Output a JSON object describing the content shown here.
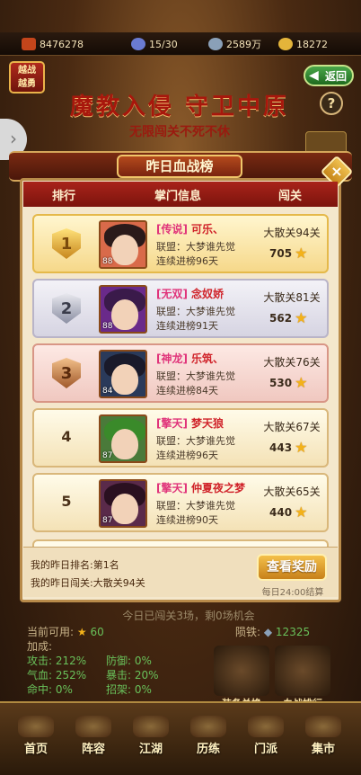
{
  "top_bar": {
    "power_icon_text": "功力",
    "power": "8476278",
    "stamina": "15/30",
    "silver": "2589万",
    "gold": "18272"
  },
  "banner": {
    "side_badge_line1": "越战",
    "side_badge_line2": "越勇",
    "back_label": "返回",
    "title": "魔教入侵 守卫中原",
    "subtitle": "无限闯关不死不休",
    "help": "?"
  },
  "modal": {
    "title": "昨日血战榜",
    "close": "×",
    "columns": {
      "rank": "排行",
      "info": "掌门信息",
      "stage": "闯关"
    },
    "rows": [
      {
        "rank": "1",
        "title": "[传说]",
        "name": "可乐、",
        "alliance": "联盟：大梦谁先觉",
        "streak": "连续进榜96天",
        "stage": "大散关94关",
        "stars": "705",
        "level": "88"
      },
      {
        "rank": "2",
        "title": "[无双]",
        "name": "念奴娇",
        "alliance": "联盟：大梦谁先觉",
        "streak": "连续进榜91天",
        "stage": "大散关81关",
        "stars": "562",
        "level": "88"
      },
      {
        "rank": "3",
        "title": "[神龙]",
        "name": "乐筑、",
        "alliance": "联盟：大梦谁先觉",
        "streak": "连续进榜84天",
        "stage": "大散关76关",
        "stars": "530",
        "level": "84"
      },
      {
        "rank": "4",
        "title": "[擎天]",
        "name": "梦天狼",
        "alliance": "联盟：大梦谁先觉",
        "streak": "连续进榜96天",
        "stage": "大散关67关",
        "stars": "443",
        "level": "87"
      },
      {
        "rank": "5",
        "title": "[擎天]",
        "name": "仲夏夜之梦",
        "alliance": "联盟：大梦谁先觉",
        "streak": "连续进榜90天",
        "stage": "大散关65关",
        "stars": "440",
        "level": "87"
      }
    ],
    "my_rank": "我的昨日排名:第1名",
    "my_stage": "我的昨日闯关:大散关94关",
    "reward_button": "查看奖励",
    "settle_note": "每日24:00结算"
  },
  "lower": {
    "today_note": "今日已闯关3场，剩0场机会",
    "available_label": "当前可用:",
    "available_value": "60",
    "meteor_label": "陨铁:",
    "meteor_value": "12325",
    "bonus_label": "加成:",
    "attack": "攻击: 212%",
    "defense": "防御: 0%",
    "hp": "气血: 252%",
    "crit": "暴击: 20%",
    "hit": "命中: 0%",
    "dodge": "招架: 0%",
    "equip_exchange": "装备兑换",
    "blood_rank": "血战排行"
  },
  "nav": [
    "首页",
    "阵容",
    "江湖",
    "历练",
    "门派",
    "集市"
  ]
}
